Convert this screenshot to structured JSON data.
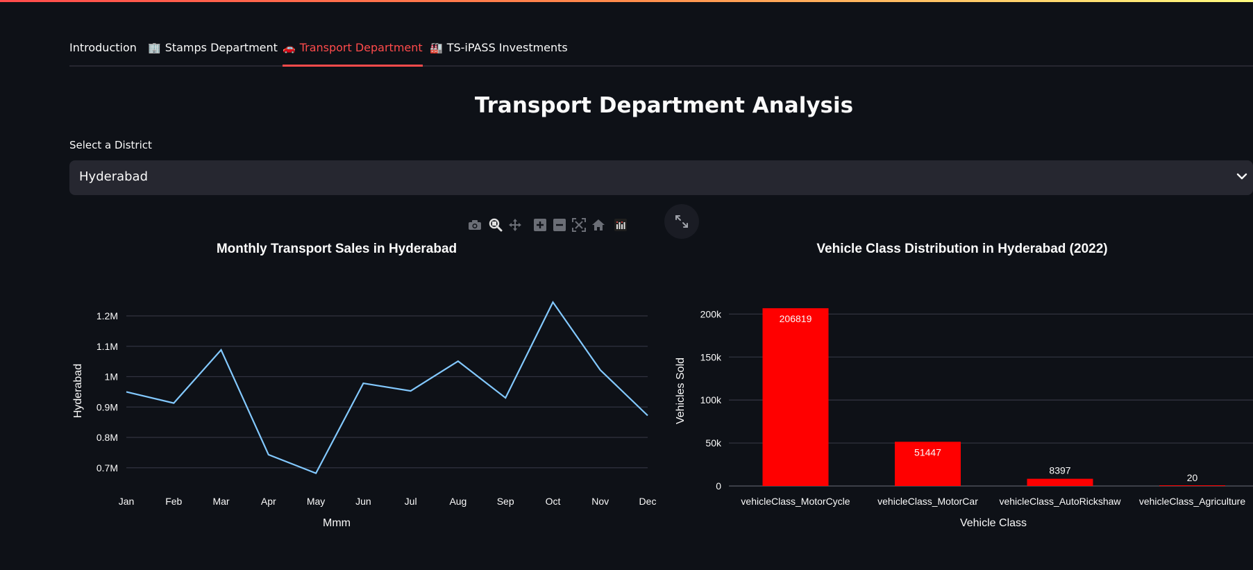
{
  "tabs": [
    {
      "label": "Introduction",
      "icon": ""
    },
    {
      "label": "Stamps Department",
      "icon": "office-building-icon"
    },
    {
      "label": "Transport Department",
      "icon": "car-icon",
      "active": true
    },
    {
      "label": "TS-iPASS Investments",
      "icon": "factory-icon"
    }
  ],
  "page": {
    "title": "Transport Department Analysis"
  },
  "district_select": {
    "label": "Select a District",
    "value": "Hyderabad"
  },
  "modebar": {
    "buttons": [
      "camera-icon",
      "zoom-icon",
      "pan-icon",
      "zoom-in-icon",
      "zoom-out-icon",
      "autoscale-icon",
      "reset-axes-icon",
      "plotly-logo-icon"
    ],
    "fullscreen": "fullscreen-icon"
  },
  "colors": {
    "accent": "#ff4b4b",
    "line": "#83c9ff",
    "bar": "#ff0000",
    "background": "#0e1117",
    "grid": "#31333f"
  },
  "chart_data": [
    {
      "type": "line",
      "title": "Monthly Transport Sales in Hyderabad",
      "xlabel": "Mmm",
      "ylabel": "Hyderabad",
      "categories": [
        "Jan",
        "Feb",
        "Mar",
        "Apr",
        "May",
        "Jun",
        "Jul",
        "Aug",
        "Sep",
        "Oct",
        "Nov",
        "Dec"
      ],
      "series": [
        {
          "values": [
            950000,
            913000,
            1088000,
            743000,
            682000,
            978000,
            953000,
            1051000,
            930000,
            1245000,
            1022000,
            872000
          ]
        }
      ],
      "yticks": [
        700000,
        800000,
        900000,
        1000000,
        1100000,
        1200000
      ],
      "ytick_labels": [
        "0.7M",
        "0.8M",
        "0.9M",
        "1M",
        "1.1M",
        "1.2M"
      ],
      "ylim": [
        640000,
        1280000
      ],
      "grid": true
    },
    {
      "type": "bar",
      "title": "Vehicle Class Distribution in Hyderabad (2022)",
      "xlabel": "Vehicle Class",
      "ylabel": "Vehicles Sold",
      "categories": [
        "vehicleClass_MotorCycle",
        "vehicleClass_MotorCar",
        "vehicleClass_AutoRickshaw",
        "vehicleClass_Agriculture"
      ],
      "values": [
        206819,
        51447,
        8397,
        20
      ],
      "data_labels": [
        "206819",
        "51447",
        "8397",
        "20"
      ],
      "yticks": [
        0,
        50000,
        100000,
        150000,
        200000
      ],
      "ytick_labels": [
        "0",
        "50k",
        "100k",
        "150k",
        "200k"
      ],
      "ylim": [
        0,
        210000
      ],
      "grid": true
    }
  ]
}
